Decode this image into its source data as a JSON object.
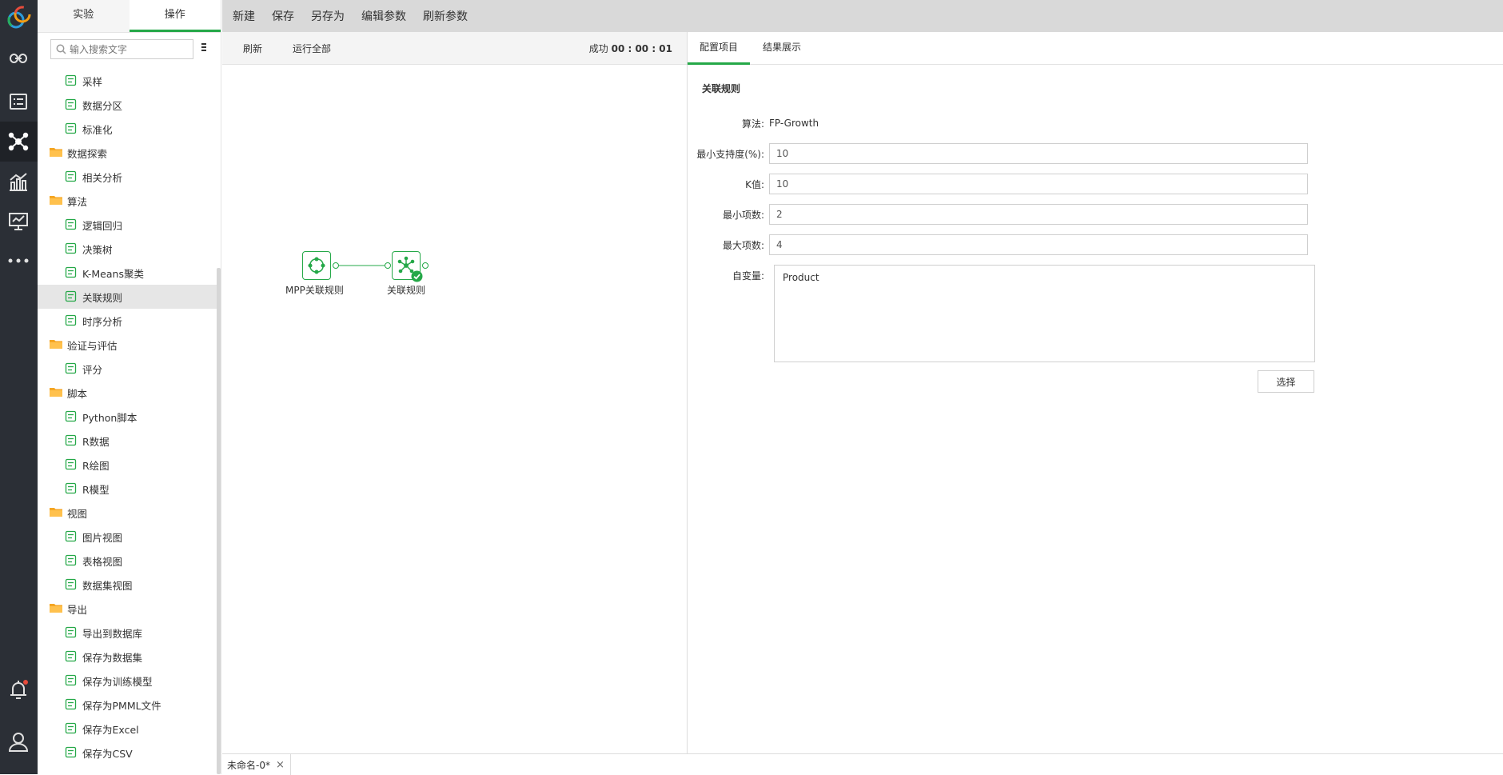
{
  "colors": {
    "accent": "#25a848",
    "nav_bg": "#2b2f36",
    "toolbar_bg": "#d9d9d9"
  },
  "leftnav": {
    "icons": [
      "link-icon",
      "list-icon",
      "network-icon",
      "chart-icon",
      "presentation-icon",
      "more-icon",
      "bell-icon",
      "user-icon"
    ]
  },
  "sidebar": {
    "tabs": [
      "实验",
      "操作"
    ],
    "search_placeholder": "输入搜索文字",
    "items": [
      {
        "type": "leaf",
        "label": "采样",
        "icon": "sample-icon"
      },
      {
        "type": "leaf",
        "label": "数据分区",
        "icon": "partition-icon"
      },
      {
        "type": "leaf",
        "label": "标准化",
        "icon": "normalize-icon"
      },
      {
        "type": "folder",
        "label": "数据探索",
        "icon": "folder-icon"
      },
      {
        "type": "leaf",
        "label": "相关分析",
        "icon": "correlation-icon"
      },
      {
        "type": "folder",
        "label": "算法",
        "icon": "folder-icon"
      },
      {
        "type": "leaf",
        "label": "逻辑回归",
        "icon": "regression-icon"
      },
      {
        "type": "leaf",
        "label": "决策树",
        "icon": "tree-icon"
      },
      {
        "type": "leaf",
        "label": "K-Means聚类",
        "icon": "cluster-icon"
      },
      {
        "type": "leaf",
        "label": "关联规则",
        "icon": "association-icon",
        "selected": true
      },
      {
        "type": "leaf",
        "label": "时序分析",
        "icon": "timeseries-icon"
      },
      {
        "type": "folder",
        "label": "验证与评估",
        "icon": "folder-icon"
      },
      {
        "type": "leaf",
        "label": "评分",
        "icon": "score-icon"
      },
      {
        "type": "folder",
        "label": "脚本",
        "icon": "folder-icon"
      },
      {
        "type": "leaf",
        "label": "Python脚本",
        "icon": "python-icon"
      },
      {
        "type": "leaf",
        "label": "R数据",
        "icon": "r-data-icon"
      },
      {
        "type": "leaf",
        "label": "R绘图",
        "icon": "r-plot-icon"
      },
      {
        "type": "leaf",
        "label": "R模型",
        "icon": "r-model-icon"
      },
      {
        "type": "folder",
        "label": "视图",
        "icon": "folder-icon"
      },
      {
        "type": "leaf",
        "label": "图片视图",
        "icon": "image-view-icon"
      },
      {
        "type": "leaf",
        "label": "表格视图",
        "icon": "table-view-icon"
      },
      {
        "type": "leaf",
        "label": "数据集视图",
        "icon": "dataset-view-icon"
      },
      {
        "type": "folder",
        "label": "导出",
        "icon": "folder-icon"
      },
      {
        "type": "leaf",
        "label": "导出到数据库",
        "icon": "export-db-icon"
      },
      {
        "type": "leaf",
        "label": "保存为数据集",
        "icon": "save-dataset-icon"
      },
      {
        "type": "leaf",
        "label": "保存为训练模型",
        "icon": "save-model-icon"
      },
      {
        "type": "leaf",
        "label": "保存为PMML文件",
        "icon": "save-pmml-icon"
      },
      {
        "type": "leaf",
        "label": "保存为Excel",
        "icon": "save-excel-icon"
      },
      {
        "type": "leaf",
        "label": "保存为CSV",
        "icon": "save-csv-icon"
      }
    ]
  },
  "toolbar": {
    "new": "新建",
    "save": "保存",
    "save_as": "另存为",
    "edit_params": "编辑参数",
    "refresh_params": "刷新参数"
  },
  "canvas": {
    "refresh": "刷新",
    "run_all": "运行全部",
    "status_label": "成功",
    "status_time": "00 : 00 : 01",
    "nodes": [
      {
        "label": "MPP关联规则",
        "icon": "mpp-association-icon"
      },
      {
        "label": "关联规则",
        "icon": "association-icon",
        "status": "success"
      }
    ]
  },
  "rightpanel": {
    "tabs": [
      "配置项目",
      "结果展示"
    ],
    "section_title": "关联规则",
    "algorithm_label": "算法:",
    "algorithm_value": "FP-Growth",
    "min_support_label": "最小支持度(%):",
    "min_support_value": "10",
    "k_label": "K值:",
    "k_value": "10",
    "min_items_label": "最小项数:",
    "min_items_value": "2",
    "max_items_label": "最大项数:",
    "max_items_value": "4",
    "variables_label": "自变量:",
    "variables_value": "Product",
    "select_button": "选择"
  },
  "bottom": {
    "doc_tab": "未命名-0*",
    "close": "×"
  }
}
